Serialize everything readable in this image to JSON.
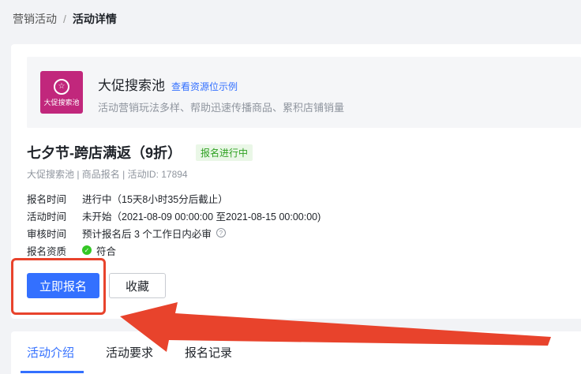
{
  "breadcrumb": {
    "parent": "营销活动",
    "separator": "/",
    "current": "活动详情"
  },
  "resource": {
    "logo_caption": "大促搜索池",
    "logo_icon": "star-in-circle-icon",
    "title": "大促搜索池",
    "link": "查看资源位示例",
    "description": "活动营销玩法多样、帮助迅速传播商品、累积店铺销量"
  },
  "activity": {
    "title": "七夕节-跨店满返（9折）",
    "status": "报名进行中",
    "meta": "大促搜索池 | 商品报名 | 活动ID: 17894"
  },
  "info": [
    {
      "label": "报名时间",
      "value": "进行中（15天8小时35分后截止）"
    },
    {
      "label": "活动时间",
      "value": "未开始（2021-08-09 00:00:00 至2021-08-15 00:00:00)"
    },
    {
      "label": "审核时间",
      "value": "预计报名后 3 个工作日内必审"
    },
    {
      "label": "报名资质",
      "value": "符合"
    }
  ],
  "buttons": {
    "signup": "立即报名",
    "favorite": "收藏"
  },
  "tabs": [
    "活动介绍",
    "活动要求",
    "报名记录"
  ],
  "colors": {
    "primary": "#3370ff",
    "annotation": "#e8432c",
    "logo_bg": "#c1277c",
    "success": "#2ea121"
  }
}
